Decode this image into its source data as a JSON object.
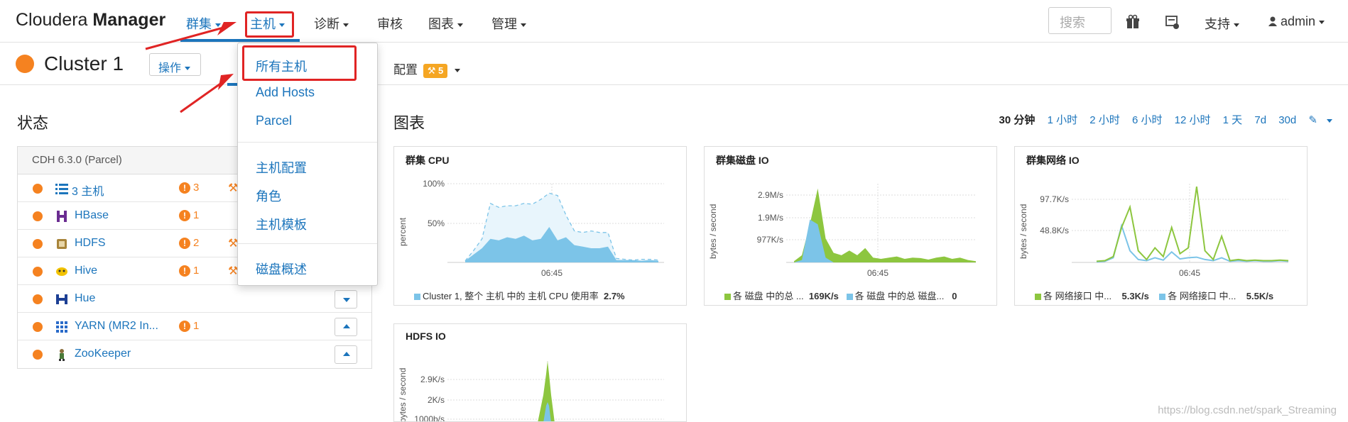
{
  "brand": {
    "light": "Cloudera",
    "bold": "Manager"
  },
  "nav": {
    "items": [
      {
        "label": "群集",
        "caret": true,
        "active": true
      },
      {
        "label": "主机",
        "caret": true,
        "active": true
      },
      {
        "label": "诊断",
        "caret": true
      },
      {
        "label": "审核",
        "caret": false
      },
      {
        "label": "图表",
        "caret": true
      },
      {
        "label": "管理",
        "caret": true
      }
    ],
    "search_placeholder": "搜索",
    "support_label": "支持",
    "user_label": "admin"
  },
  "cluster": {
    "name": "Cluster 1",
    "ops_label": "操作",
    "config_label": "配置",
    "config_badge": "5"
  },
  "dropdown": {
    "items": [
      "所有主机",
      "Add Hosts",
      "Parcel",
      "主机配置",
      "角色",
      "主机模板",
      "磁盘概述"
    ]
  },
  "status": {
    "title": "状态",
    "cdh_header": "CDH 6.3.0 (Parcel)",
    "services": [
      {
        "name": "3 主机",
        "icon": "list-icon",
        "warn": "3",
        "wrench": true
      },
      {
        "name": "HBase",
        "icon": "hbase-icon",
        "warn": "1"
      },
      {
        "name": "HDFS",
        "icon": "hdfs-icon",
        "warn": "2",
        "wrench": true
      },
      {
        "name": "Hive",
        "icon": "hive-icon",
        "warn": "1",
        "wrench": true
      },
      {
        "name": "Hue",
        "icon": "hue-icon",
        "warn": "",
        "btn": "down"
      },
      {
        "name": "YARN (MR2 In...",
        "icon": "yarn-icon",
        "warn": "1",
        "btn": "up"
      },
      {
        "name": "ZooKeeper",
        "icon": "zookeeper-icon",
        "warn": "",
        "btn": "up"
      }
    ]
  },
  "charts": {
    "title": "图表",
    "time_ranges": [
      "30 分钟",
      "1 小时",
      "2 小时",
      "6 小时",
      "12 小时",
      "1 天",
      "7d",
      "30d"
    ],
    "selected_range": "30 分钟",
    "xtick": "06:45",
    "cpu": {
      "title": "群集 CPU",
      "ylabel": "percent",
      "yticks": [
        "100%",
        "50%"
      ],
      "legend": "Cluster 1, 整个 主机 中的 主机 CPU 使用率",
      "legend_value": "2.7%"
    },
    "disk": {
      "title": "群集磁盘 IO",
      "ylabel": "bytes / second",
      "yticks": [
        "2.9M/s",
        "1.9M/s",
        "977K/s"
      ],
      "legend1": "各 磁盘 中的总 ...",
      "legend1_value": "169K/s",
      "legend2": "各 磁盘 中的总 磁盘...",
      "legend2_value": "0"
    },
    "net": {
      "title": "群集网络 IO",
      "ylabel": "bytes / second",
      "yticks": [
        "97.7K/s",
        "48.8K/s"
      ],
      "legend1": "各 网络接口 中...",
      "legend1_value": "5.3K/s",
      "legend2": "各 网络接口 中...",
      "legend2_value": "5.5K/s"
    },
    "hdfs": {
      "title": "HDFS IO",
      "ylabel": "bytes / second",
      "yticks": [
        "2.9K/s",
        "2K/s",
        "1000b/s"
      ]
    }
  },
  "chart_data": [
    {
      "type": "area",
      "title": "群集 CPU",
      "ylabel": "percent",
      "ylim": [
        0,
        100
      ],
      "series": [
        {
          "name": "Cluster 1, 整个 主机 中的 主机 CPU 使用率",
          "values": [
            2,
            10,
            18,
            30,
            28,
            32,
            30,
            34,
            28,
            30,
            45,
            28,
            32,
            22,
            20,
            18,
            18,
            20,
            3,
            3,
            3,
            2,
            3,
            2
          ]
        },
        {
          "values": [
            2,
            15,
            30,
            75,
            70,
            72,
            72,
            75,
            74,
            80,
            88,
            85,
            60,
            40,
            38,
            40,
            38,
            38,
            5,
            4,
            3,
            4,
            4,
            3
          ]
        }
      ]
    },
    {
      "type": "area",
      "title": "群集磁盘 IO",
      "ylabel": "bytes / second",
      "series": [
        {
          "name": "各 磁盘 中的总 ...",
          "values": [
            0.05,
            0.3,
            1.6,
            3.1,
            1.0,
            0.4,
            0.3,
            0.5,
            0.3,
            0.6,
            0.2,
            0.15,
            0.2,
            0.25,
            0.15,
            0.2,
            0.18,
            0.12,
            0.2,
            0.25,
            0.15,
            0.2,
            0.1,
            0.05
          ]
        },
        {
          "name": "各 磁盘 中的总 磁盘...",
          "values": [
            0,
            0.1,
            1.8,
            1.6,
            0.2,
            0,
            0,
            0,
            0,
            0,
            0,
            0,
            0,
            0,
            0,
            0,
            0,
            0,
            0,
            0,
            0,
            0,
            0,
            0
          ]
        }
      ]
    },
    {
      "type": "line",
      "title": "群集网络 IO",
      "ylabel": "bytes / second",
      "series": [
        {
          "name": "各 网络接口 中...",
          "values": [
            2,
            3,
            10,
            60,
            95,
            20,
            5,
            25,
            10,
            60,
            15,
            25,
            130,
            20,
            5,
            45,
            3,
            5,
            3,
            4,
            3,
            3,
            4,
            3
          ]
        },
        {
          "name": "各 网络接口 中...",
          "values": [
            1,
            2,
            8,
            63,
            20,
            5,
            3,
            8,
            4,
            18,
            6,
            8,
            9,
            5,
            3,
            8,
            2,
            3,
            2,
            3,
            2,
            2,
            3,
            2
          ]
        }
      ]
    },
    {
      "type": "area",
      "title": "HDFS IO",
      "ylabel": "bytes / second"
    }
  ],
  "watermark": "https://blog.csdn.net/spark_Streaming"
}
